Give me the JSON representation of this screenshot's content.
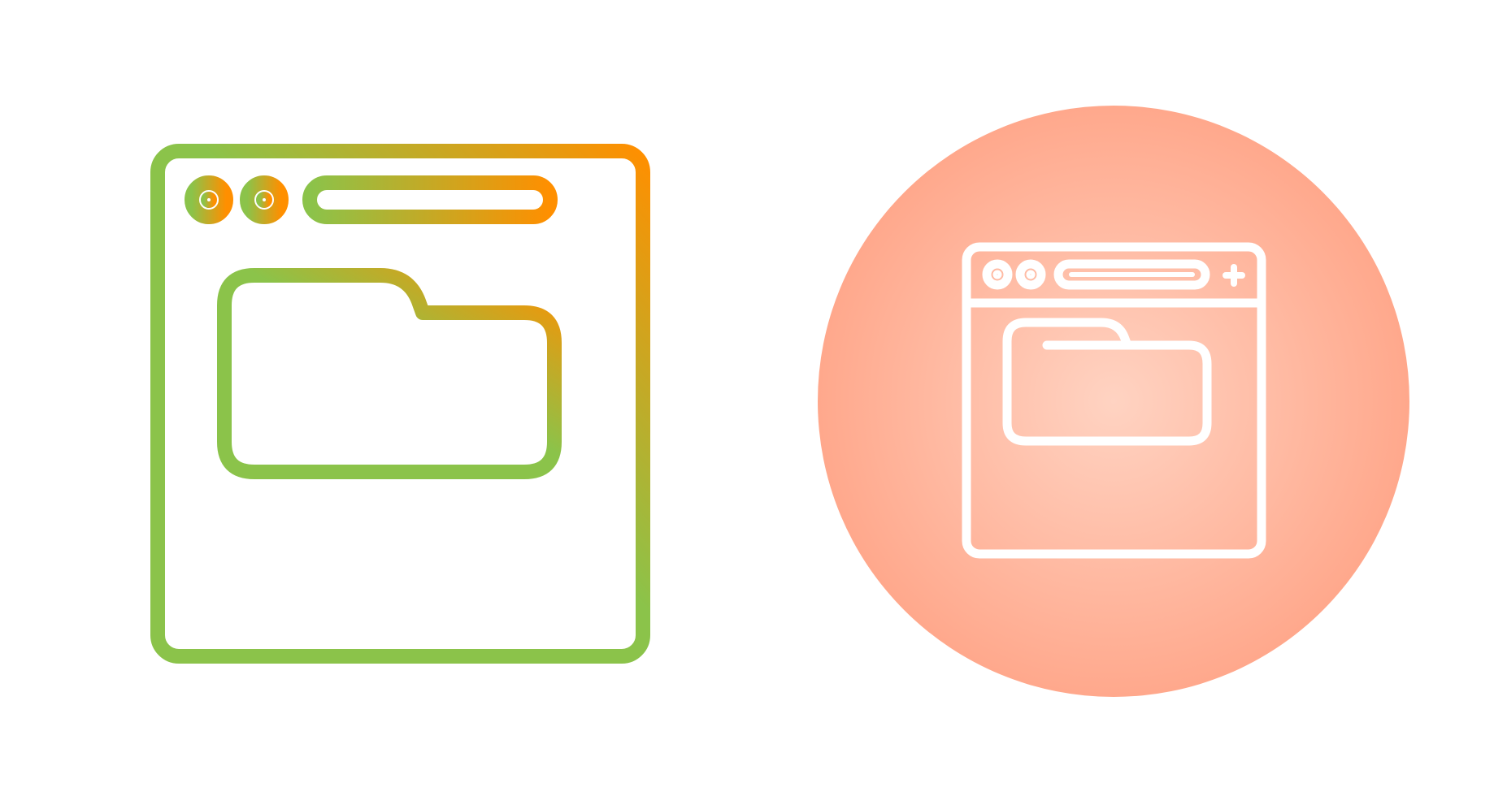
{
  "icons": [
    {
      "name": "browser-folder-icon-gradient",
      "gradient_start": "#8bc34a",
      "gradient_end": "#ff8f00"
    },
    {
      "name": "browser-folder-icon-white-on-circle",
      "stroke": "#ffffff",
      "circle_center": "#ffd3c2",
      "circle_edge": "#ffa88c"
    }
  ]
}
